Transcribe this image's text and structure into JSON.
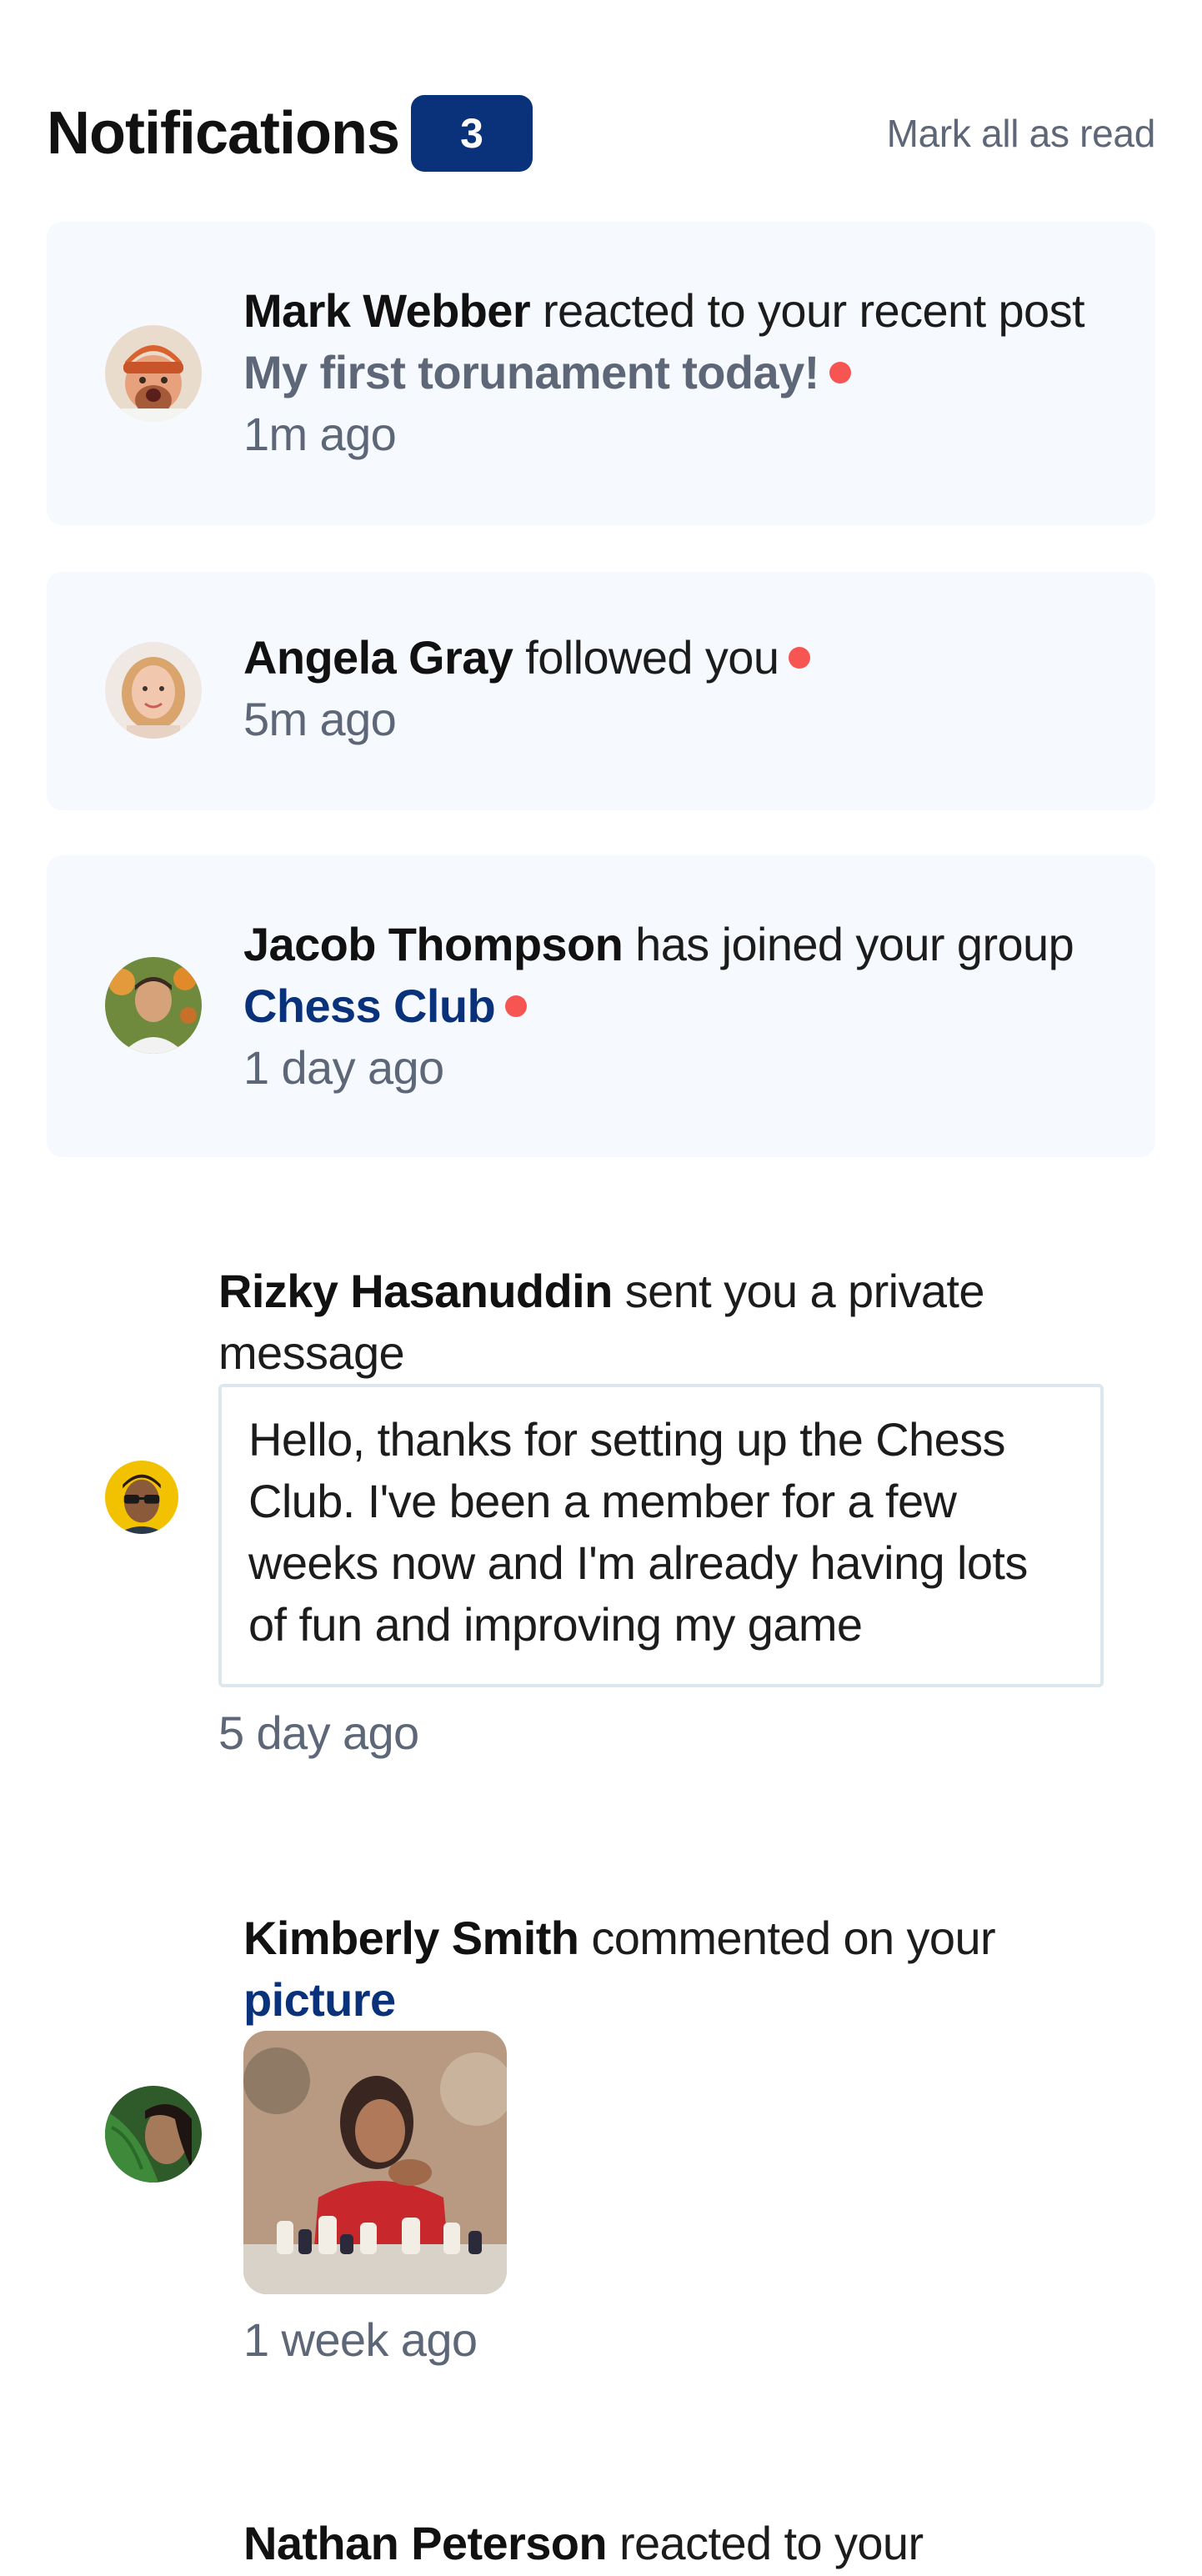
{
  "header": {
    "title": "Notifications",
    "unread_count": "3",
    "mark_all_label": "Mark all as read"
  },
  "colors": {
    "unread_bg": "#f6f9fe",
    "accent_blue": "#0a327b",
    "unread_dot": "#f65552",
    "muted_text": "#5d6778",
    "message_border": "#dde7ee"
  },
  "notifications": [
    {
      "name": "Mark Webber",
      "action": "reacted to your recent post",
      "target": "My first torunament today!",
      "time": "1m ago",
      "unread": true
    },
    {
      "name": "Angela Gray",
      "action": "followed you",
      "time": "5m ago",
      "unread": true
    },
    {
      "name": "Jacob Thompson",
      "action": "has joined your group",
      "target": "Chess Club",
      "time": "1 day ago",
      "unread": true
    },
    {
      "name": "Rizky Hasanuddin",
      "action": "sent you a private message",
      "message": "Hello, thanks for setting up the Chess Club. I've been a member for a few weeks now and I'm already having lots of fun and improving my game",
      "time": "5 day ago",
      "unread": false
    },
    {
      "name": "Kimberly Smith",
      "action": "commented on your",
      "target": "picture",
      "time": "1 week ago",
      "unread": false
    },
    {
      "name": "Nathan Peterson",
      "action": "reacted to your",
      "unread": false
    }
  ]
}
